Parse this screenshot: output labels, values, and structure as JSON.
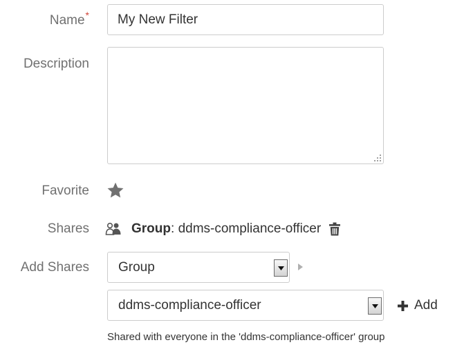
{
  "form": {
    "name_label": "Name",
    "required_marker": "*",
    "name_value": "My New Filter",
    "description_label": "Description",
    "description_value": "",
    "favorite_label": "Favorite",
    "favorite_icon": "star-icon",
    "shares_label": "Shares",
    "share_entry": {
      "icon": "group-icon",
      "type": "Group",
      "separator": ":",
      "name": "ddms-compliance-officer",
      "delete_icon": "trash-icon"
    },
    "add_shares_label": "Add Shares",
    "share_type_select": "Group",
    "group_select": "ddms-compliance-officer",
    "add_button": "Add",
    "hint": "Shared with everyone in the 'ddms-compliance-officer' group"
  }
}
